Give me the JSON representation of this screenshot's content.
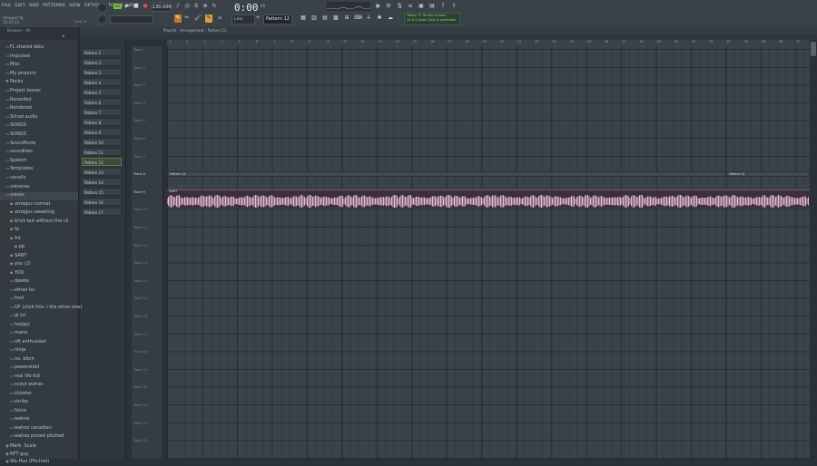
{
  "menu": [
    "FILE",
    "EDIT",
    "ADD",
    "PATTERNS",
    "VIEW",
    "OPTIONS",
    "TOOLS",
    "HELP"
  ],
  "project": {
    "name": "Amoguscfg",
    "time": "32:01:23"
  },
  "hint": "Step 16",
  "transport": {
    "pattern_tag": "PAT",
    "tempo": "130.000",
    "time": "0:00",
    "time_small": "00"
  },
  "snap": {
    "line": "Line",
    "pattern": "Pattern 12"
  },
  "news": {
    "line1": "Today: FL Studio version",
    "line2": "20.8.3 build 2304 is available!"
  },
  "playlist": {
    "breadcrumb": "Playlist - Arrangement › Pattern 12"
  },
  "browser": {
    "title": "Browser - All",
    "items": [
      {
        "icon": "folder",
        "label": "FL shared data"
      },
      {
        "icon": "folder",
        "label": "Impulses"
      },
      {
        "icon": "folder",
        "label": "Misc"
      },
      {
        "icon": "folder",
        "label": "My projects"
      },
      {
        "icon": "packs",
        "label": "Packs"
      },
      {
        "icon": "folder",
        "label": "Project bones"
      },
      {
        "icon": "folder",
        "label": "Recorded"
      },
      {
        "icon": "folder",
        "label": "Rendered"
      },
      {
        "icon": "folder",
        "label": "Sliced audio"
      },
      {
        "icon": "folder",
        "label": "SONGS"
      },
      {
        "icon": "folder",
        "label": "SONGS"
      },
      {
        "icon": "folder",
        "label": "Soundfonts"
      },
      {
        "icon": "folder",
        "label": "soundloss"
      },
      {
        "icon": "folder",
        "label": "Speech"
      },
      {
        "icon": "folder",
        "label": "Templates"
      },
      {
        "icon": "folder",
        "label": "vocalls"
      },
      {
        "icon": "folder",
        "label": "voiceces"
      },
      {
        "icon": "folder",
        "label": "voices"
      }
    ],
    "sub_items": [
      {
        "label": "amogus normal",
        "depth": 1
      },
      {
        "label": "amogus sweating",
        "depth": 1
      },
      {
        "label": "brick but without the ck",
        "depth": 1
      },
      {
        "label": "fa",
        "depth": 1
      },
      {
        "label": "fnt",
        "depth": 1
      },
      {
        "label": "pp",
        "depth": 2
      },
      {
        "label": "SANT",
        "depth": 1
      },
      {
        "label": "you (2)",
        "depth": 1
      },
      {
        "label": "YOU",
        "depth": 1
      },
      {
        "label": "dawko",
        "depth": 1
      },
      {
        "label": "ethan lol",
        "depth": 1
      },
      {
        "label": "fred",
        "depth": 1
      },
      {
        "label": "GF (click this..i the other one)",
        "depth": 1
      },
      {
        "label": "gl lol",
        "depth": 1
      },
      {
        "label": "helppy",
        "depth": 1
      },
      {
        "label": "mario",
        "depth": 1
      },
      {
        "label": "nft enthusiast",
        "depth": 1
      },
      {
        "label": "ninja",
        "depth": 1
      },
      {
        "label": "no. bitch",
        "depth": 1
      },
      {
        "label": "powershell",
        "depth": 1
      },
      {
        "label": "real life kid",
        "depth": 1
      },
      {
        "label": "scout wahoo",
        "depth": 1
      },
      {
        "label": "shooter",
        "depth": 1
      },
      {
        "label": "skribo",
        "depth": 1
      },
      {
        "label": "Sonic",
        "depth": 1
      },
      {
        "label": "wahoo",
        "depth": 1
      },
      {
        "label": "wahoo canadian",
        "depth": 1
      },
      {
        "label": "wahoo pissed pitched",
        "depth": 1
      }
    ],
    "bottom_items": [
      {
        "label": "Mark. Scale"
      },
      {
        "label": "NFT guy"
      },
      {
        "label": "Wa-Hoo (Pitched)"
      }
    ]
  },
  "patterns": [
    "Pattern 1",
    "Pattern 2",
    "Pattern 3",
    "Pattern 4",
    "Pattern 5",
    "Pattern 6",
    "Pattern 7",
    "Pattern 8",
    "Pattern 9",
    "Pattern 10",
    "Pattern 11",
    "Pattern 12",
    "Pattern 13",
    "Pattern 14",
    "Pattern 15",
    "Pattern 16",
    "Pattern 17"
  ],
  "selected_pattern_index": 11,
  "ruler": [
    "1",
    "2",
    "3",
    "4",
    "5",
    "6",
    "7",
    "8",
    "9",
    "10",
    "11",
    "12",
    "13",
    "14",
    "15",
    "16",
    "17",
    "18",
    "19",
    "20",
    "21",
    "22",
    "23",
    "24",
    "25",
    "26",
    "27",
    "28",
    "29",
    "30",
    "31",
    "32",
    "33",
    "34",
    "35",
    "36",
    "37"
  ],
  "tracks": [
    "Track 1",
    "Track 2",
    "Track 3",
    "Track 4",
    "Track 5",
    "Track 6",
    "Track 7",
    "Track 8",
    "Track 9",
    "Track 10",
    "Track 11",
    "Track 12",
    "Track 13",
    "Track 14",
    "Track 15",
    "Track 16",
    "Track 17",
    "Track 18",
    "Track 19",
    "Track 20",
    "Track 21",
    "Track 22",
    "Track 23"
  ],
  "active_tracks": [
    7,
    8
  ],
  "clips": {
    "pattern_a": "Pattern 12",
    "pattern_b": "Pattern 12",
    "audio": "SANT"
  },
  "colors": {
    "accent_green": "#7dbf3d",
    "audio_wave": "#e6b8d8",
    "background": "#3a434c"
  }
}
